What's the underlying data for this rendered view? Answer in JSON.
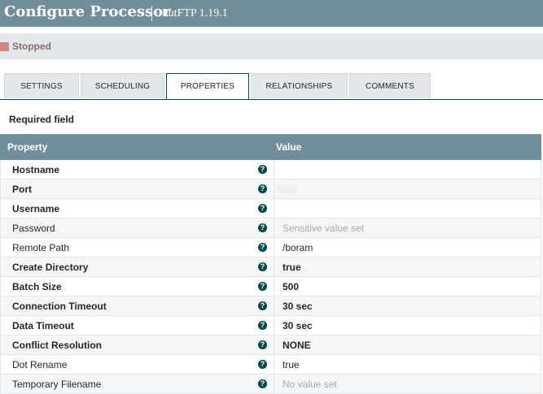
{
  "header": {
    "title": "Configure Processor",
    "subtitle": "PutFTP 1.19.1"
  },
  "status": {
    "label": "Stopped",
    "color": "#d18686"
  },
  "tabs": [
    {
      "label": "SETTINGS",
      "active": false
    },
    {
      "label": "SCHEDULING",
      "active": false
    },
    {
      "label": "PROPERTIES",
      "active": true
    },
    {
      "label": "RELATIONSHIPS",
      "active": false
    },
    {
      "label": "COMMENTS",
      "active": false
    }
  ],
  "required_field_label": "Required field",
  "table": {
    "columns": [
      "Property",
      "Value"
    ],
    "rows": [
      {
        "name": "Hostname",
        "value": "",
        "required": true
      },
      {
        "name": "Port",
        "value": "",
        "required": true
      },
      {
        "name": "Username",
        "value": "",
        "required": true
      },
      {
        "name": "Password",
        "value": "Sensitive value set",
        "required": false
      },
      {
        "name": "Remote Path",
        "value": "/boram",
        "required": false
      },
      {
        "name": "Create Directory",
        "value": "true",
        "required": true
      },
      {
        "name": "Batch Size",
        "value": "500",
        "required": true
      },
      {
        "name": "Connection Timeout",
        "value": "30 sec",
        "required": true
      },
      {
        "name": "Data Timeout",
        "value": "30 sec",
        "required": true
      },
      {
        "name": "Conflict Resolution",
        "value": "NONE",
        "required": true
      },
      {
        "name": "Dot Rename",
        "value": "true",
        "required": false
      },
      {
        "name": "Temporary Filename",
        "value": "No value set",
        "required": false
      }
    ]
  },
  "help_icon_glyph": "?"
}
